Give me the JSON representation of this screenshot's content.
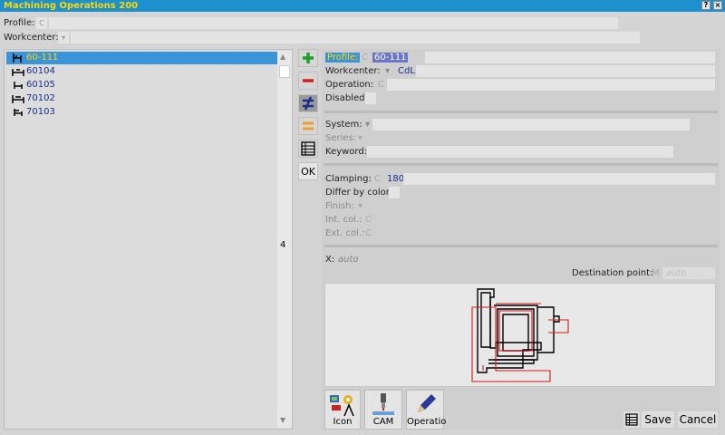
{
  "window": {
    "title": "Machining Operations 200"
  },
  "filters": {
    "profile_label": "Profile:",
    "workcenter_label": "Workcenter:"
  },
  "tree": {
    "items": [
      {
        "label": "60-111",
        "selected": true
      },
      {
        "label": "60104"
      },
      {
        "label": "60105"
      },
      {
        "label": "70102"
      },
      {
        "label": "70103"
      }
    ]
  },
  "toolbar": {
    "ok_label": "OK"
  },
  "scroll": {
    "marker": "4"
  },
  "detail": {
    "profile_label": "Profile:",
    "profile_value": "60-111",
    "workcenter_label": "Workcenter:",
    "workcenter_value": "CdL",
    "operation_label": "Operation:",
    "disabled_label": "Disabled:",
    "system_label": "System:",
    "series_label": "Series:",
    "keyword_label": "Keyword:",
    "clamping_label": "Clamping:",
    "clamping_value": "180",
    "differ_label": "Differ by color:",
    "finish_label": "Finish:",
    "intcol_label": "Int. col.:",
    "extcol_label": "Ext. col.:",
    "x_label": "X:",
    "x_value": "auto",
    "dest_label": "Destination point:",
    "dest_chip": "M",
    "dest_value": "auto",
    "chip_c": "C"
  },
  "actions": {
    "icon_label": "Icon",
    "cam_label": "CAM",
    "operation_label": "Operatio",
    "save_label": "Save",
    "cancel_label": "Cancel"
  },
  "colors": {
    "titlebar": "#1e90cc",
    "selection": "#3c94d8",
    "accent_text": "#ffd200",
    "link_text": "#1a2f8a"
  }
}
